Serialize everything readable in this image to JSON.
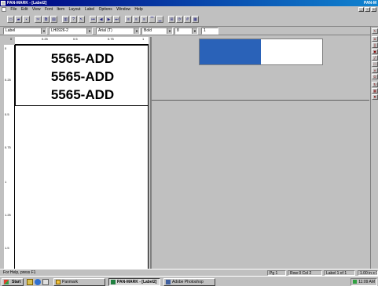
{
  "window": {
    "title": "PAN-MARK - [Label2]",
    "right_title": "PAN-M"
  },
  "menu": [
    "File",
    "Edit",
    "View",
    "Font",
    "Item",
    "Layout",
    "Label",
    "Options",
    "Window",
    "Help"
  ],
  "format": {
    "object_type": "Label",
    "label_stock": "LH0926-2",
    "font": "Arial (T)",
    "style": "Bold",
    "size": "8",
    "value": "1"
  },
  "ruler": {
    "top": [
      "0",
      "0.25",
      "0.5",
      "0.75",
      "1"
    ],
    "left": [
      "0",
      "0.25",
      "0.5",
      "0.75",
      "1",
      "1.25",
      "1.5"
    ]
  },
  "label": {
    "lines": [
      "5565-ADD",
      "5565-ADD",
      "5565-ADD"
    ]
  },
  "preview": {
    "fill_color": "#2a62b8",
    "fill_fraction": 0.5
  },
  "status": {
    "help": "For Help, press F1",
    "page": "Pg 1",
    "row_col": "Row 0 Col 2",
    "label_count": "Label 1 of 1",
    "dimensions": "1.00 in x 0.44 in"
  },
  "taskbar": {
    "start": "Start",
    "tasks": [
      "Panmark",
      "PAN-MARK - [Label2]",
      "Adobe Photoshop"
    ],
    "clock": "11:09 AM"
  }
}
